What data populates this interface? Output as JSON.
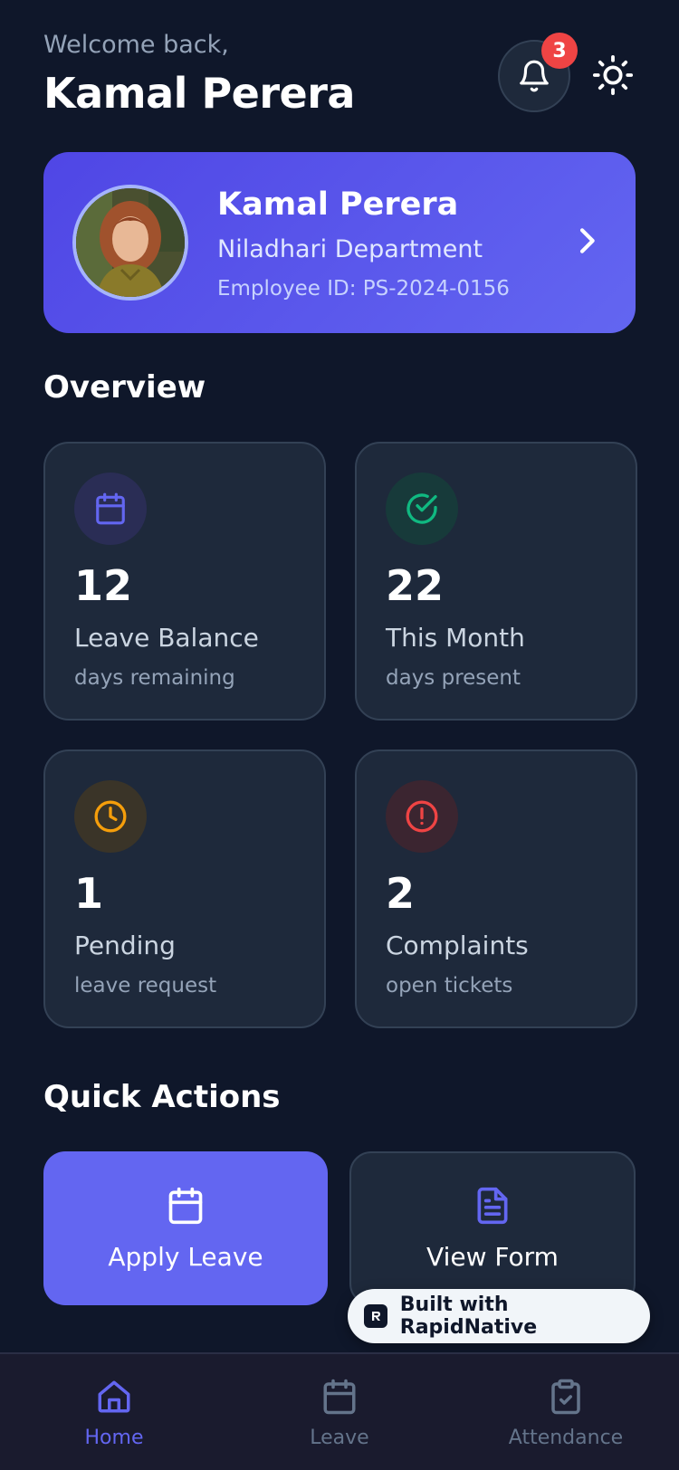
{
  "header": {
    "greeting": "Welcome back,",
    "user_name": "Kamal Perera",
    "notification_count": "3"
  },
  "profile": {
    "name": "Kamal Perera",
    "department": "Niladhari Department",
    "employee_id": "Employee ID: PS-2024-0156"
  },
  "overview": {
    "title": "Overview",
    "cards": [
      {
        "value": "12",
        "label": "Leave Balance",
        "sub": "days remaining",
        "icon": "calendar-icon",
        "color": "#6366f1",
        "bg": "#2a2d55"
      },
      {
        "value": "22",
        "label": "This Month",
        "sub": "days present",
        "icon": "check-circle-icon",
        "color": "#10b981",
        "bg": "#173a3a"
      },
      {
        "value": "1",
        "label": "Pending",
        "sub": "leave request",
        "icon": "clock-icon",
        "color": "#f59e0b",
        "bg": "#3a3428"
      },
      {
        "value": "2",
        "label": "Complaints",
        "sub": "open tickets",
        "icon": "alert-circle-icon",
        "color": "#ef4444",
        "bg": "#3b2530"
      }
    ]
  },
  "quick_actions": {
    "title": "Quick Actions",
    "apply_leave": "Apply Leave",
    "view_form": "View Form"
  },
  "built_with": "Built with RapidNative",
  "nav": {
    "home": "Home",
    "leave": "Leave",
    "attendance": "Attendance"
  },
  "colors": {
    "background": "#0f172a",
    "card": "#1e293b",
    "accent": "#6366f1",
    "badge": "#ef4444"
  }
}
